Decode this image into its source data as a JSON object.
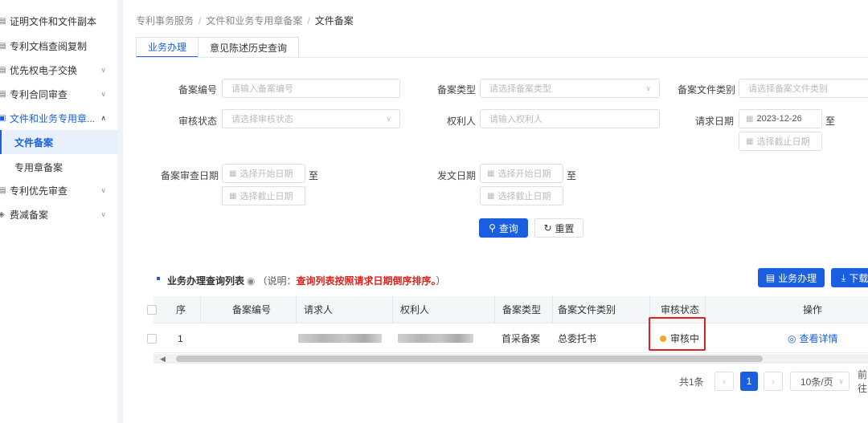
{
  "sidebar": {
    "items": [
      {
        "label": "证明文件和文件副本",
        "icon": "document-icon",
        "chevron": ""
      },
      {
        "label": "专利文档查阅复制",
        "icon": "copy-icon",
        "chevron": ""
      },
      {
        "label": "优先权电子交换",
        "icon": "exchange-icon",
        "chevron": "∨"
      },
      {
        "label": "专利合同审查",
        "icon": "contract-icon",
        "chevron": "∨"
      },
      {
        "label": "文件和业务专用章...",
        "icon": "stamp-icon",
        "chevron": "∧"
      },
      {
        "label": "专利优先审查",
        "icon": "priority-icon",
        "chevron": "∨"
      },
      {
        "label": "费减备案",
        "icon": "fee-icon",
        "chevron": "∨"
      }
    ],
    "subitems": [
      {
        "label": "文件备案"
      },
      {
        "label": "专用章备案"
      }
    ]
  },
  "breadcrumb": {
    "items": [
      "专利事务服务",
      "文件和业务专用章备案",
      "文件备案"
    ],
    "separator": "/"
  },
  "tabs": [
    {
      "label": "业务办理"
    },
    {
      "label": "意见陈述历史查询"
    }
  ],
  "form": {
    "record_no": {
      "label": "备案编号",
      "placeholder": "请输入备案编号"
    },
    "record_type": {
      "label": "备案类型",
      "placeholder": "请选择备案类型"
    },
    "record_file_type": {
      "label": "备案文件类别",
      "placeholder": "请选择备案文件类别"
    },
    "review_status": {
      "label": "审核状态",
      "placeholder": "请选择审核状态"
    },
    "right_holder": {
      "label": "权利人",
      "placeholder": "请输入权利人"
    },
    "request_date": {
      "label": "请求日期",
      "start_value": "2023-12-26",
      "end_placeholder": "选择截止日期"
    },
    "record_review_date": {
      "label": "备案审查日期",
      "start_placeholder": "选择开始日期",
      "end_placeholder": "选择截止日期"
    },
    "issue_date": {
      "label": "发文日期",
      "start_placeholder": "选择开始日期",
      "end_placeholder": "选择截止日期"
    },
    "to_label": "至",
    "query_label": "查询",
    "reset_label": "重置"
  },
  "list": {
    "title": "业务办理查询列表",
    "note_prefix": "（说明：",
    "note_red": "查询列表按照请求日期倒序排序。",
    "note_suffix": "）",
    "business_button": "业务办理",
    "download_button": "下载"
  },
  "table": {
    "columns": [
      "序",
      "备案编号",
      "请求人",
      "权利人",
      "备案类型",
      "备案文件类别",
      "审核状态",
      "操作"
    ],
    "rows": [
      {
        "index": "1",
        "record_no": "",
        "record_type": "首采备案",
        "file_type": "总委托书",
        "status": "审核中",
        "action": "查看详情"
      }
    ]
  },
  "pagination": {
    "total": "共1条",
    "current_page": "1",
    "page_size": "10条/页",
    "goto": "前往"
  },
  "colors": {
    "primary": "#1a5fe0",
    "status_pending": "#f5a623",
    "highlight": "#e0201b"
  }
}
